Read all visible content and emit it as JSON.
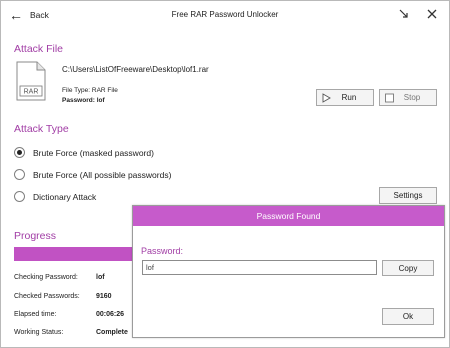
{
  "window": {
    "title": "Free RAR Password Unlocker",
    "back_label": "Back"
  },
  "attack_file": {
    "heading": "Attack File",
    "icon_text": "RAR",
    "path": "C:\\Users\\ListOfFreeware\\Desktop\\lof1.rar",
    "file_type_label": "File Type:",
    "file_type_value": "RAR File",
    "password_label": "Password:",
    "password_value": "lof",
    "run_label": "Run",
    "stop_label": "Stop"
  },
  "attack_type": {
    "heading": "Attack Type",
    "options": [
      {
        "label": "Brute Force (masked password)",
        "selected": true
      },
      {
        "label": "Brute Force (All possible passwords)",
        "selected": false
      },
      {
        "label": "Dictionary Attack",
        "selected": false
      }
    ],
    "settings_label": "Settings"
  },
  "progress": {
    "heading": "Progress",
    "percent": 100,
    "stats": [
      {
        "label": "Checking Password:",
        "value": "lof"
      },
      {
        "label": "Checked Passwords:",
        "value": "9160"
      },
      {
        "label": "Elapsed time:",
        "value": "00:06:26"
      },
      {
        "label": "Working Status:",
        "value": "Complete"
      }
    ]
  },
  "dialog": {
    "title": "Password Found",
    "password_label": "Password:",
    "password_value": "lof",
    "copy_label": "Copy",
    "ok_label": "Ok"
  },
  "colors": {
    "accent": "#a13da5",
    "dialog_header": "#c65bcb",
    "progress": "#c152c3"
  }
}
